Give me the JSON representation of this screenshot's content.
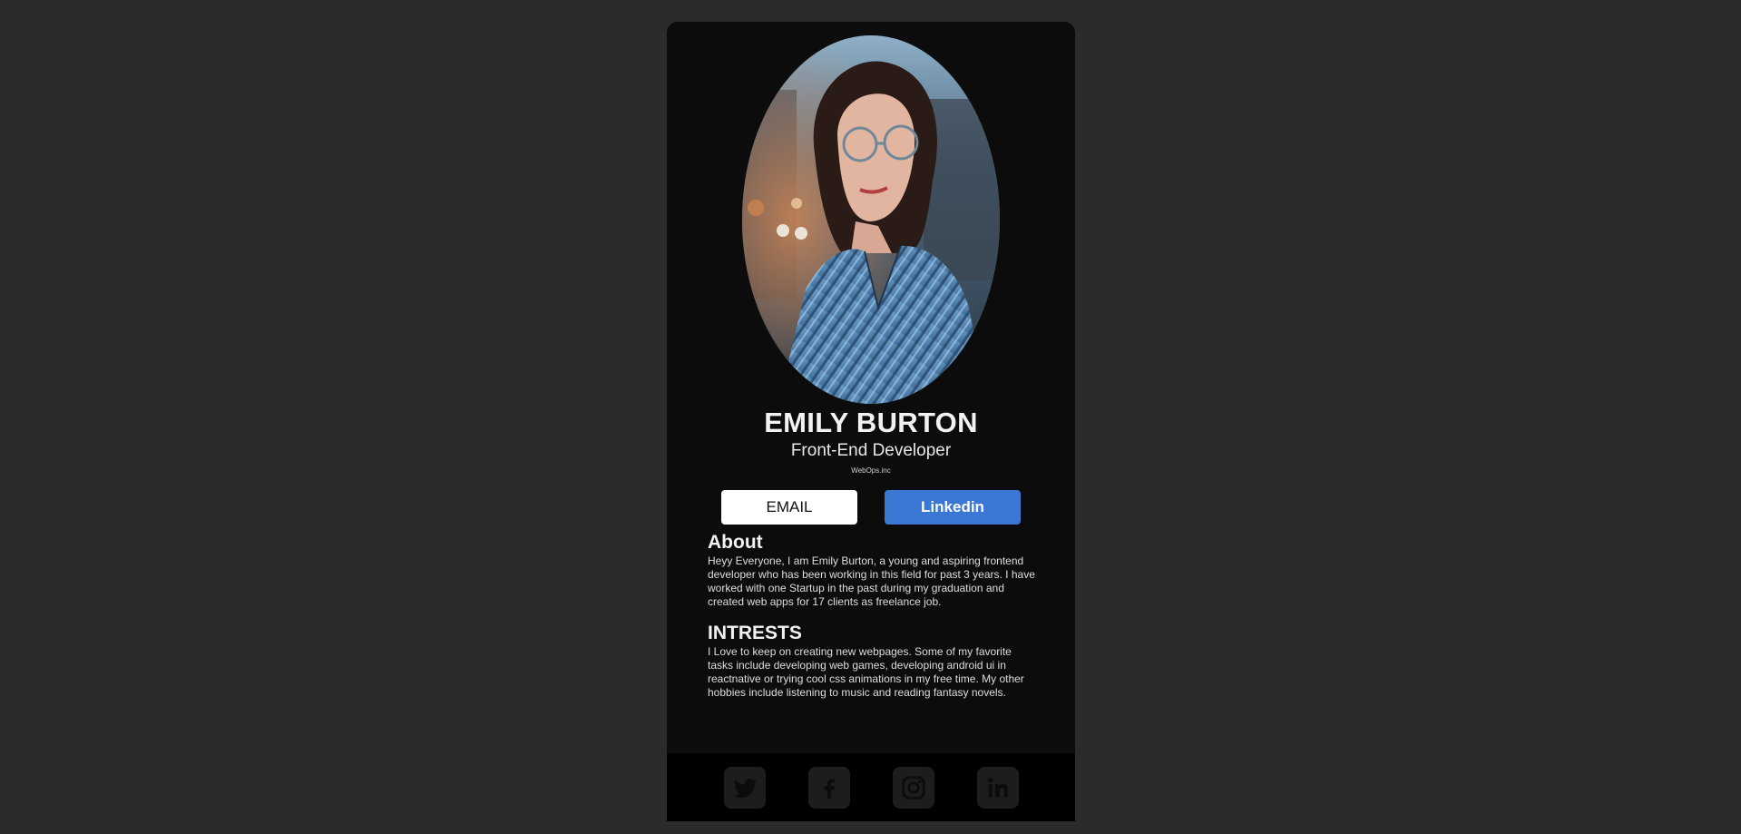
{
  "profile": {
    "name": "EMILY BURTON",
    "role": "Front-End Developer",
    "company": "WebOps.inc",
    "photo_alt": "profile-photo"
  },
  "buttons": {
    "email_label": "EMAIL",
    "linkedin_label": "Linkedin"
  },
  "about": {
    "title": "About",
    "text": "Heyy Everyone, I am Emily Burton, a young and aspiring frontend developer who has been working in this field for past 3 years. I have worked with one Startup in the past during my graduation and created web apps for 17 clients as freelance job."
  },
  "interests": {
    "title": "INTRESTS",
    "text": "I Love to keep on creating new webpages. Some of my favorite tasks include developing web games, developing android ui in reactnative or trying cool css animations in my free time. My other hobbies include listening to music and reading fantasy novels."
  },
  "footer": {
    "icons": [
      "twitter-icon",
      "facebook-icon",
      "instagram-icon",
      "linkedin-icon"
    ]
  },
  "colors": {
    "page_bg": "#2b2b2b",
    "card_bg": "#0c0c0c",
    "footer_bg": "#000000",
    "linkedin_blue": "#3b78d6",
    "email_bg": "#ffffff",
    "icon_tile": "#1d1d1d"
  }
}
